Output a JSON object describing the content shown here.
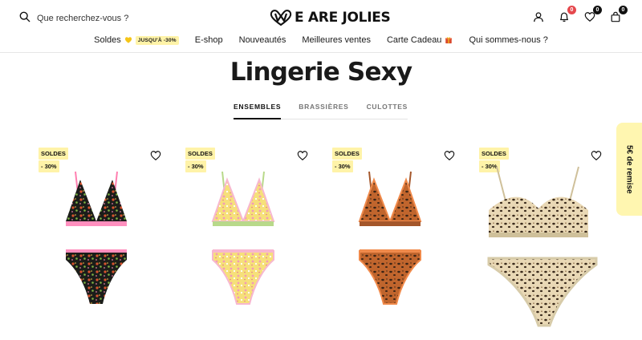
{
  "header": {
    "search_placeholder": "Que recherchez-vous ?",
    "logo_text": "E ARE JOLIES",
    "notifications_count": "0",
    "wishlist_count": "0",
    "cart_count": "0"
  },
  "nav": {
    "items": [
      {
        "label": "Soldes",
        "pill": "JUSQU'À -30%"
      },
      {
        "label": "E-shop"
      },
      {
        "label": "Nouveautés"
      },
      {
        "label": "Meilleures ventes"
      },
      {
        "label": "Carte Cadeau"
      },
      {
        "label": "Qui sommes-nous ?"
      }
    ]
  },
  "page": {
    "title": "Lingerie Sexy",
    "tabs": [
      "ENSEMBLES",
      "BRASSIÈRES",
      "CULOTTES"
    ]
  },
  "products": [
    {
      "tag": "SOLDES",
      "discount": "- 30%"
    },
    {
      "tag": "SOLDES",
      "discount": "- 30%"
    },
    {
      "tag": "SOLDES",
      "discount": "- 30%"
    },
    {
      "tag": "SOLDES",
      "discount": "- 30%"
    }
  ],
  "promo": {
    "label": "5€ de remise"
  },
  "colors": {
    "accent_yellow": "#fff3a8",
    "badge_red": "#e5484d",
    "text": "#1a1a1a"
  }
}
